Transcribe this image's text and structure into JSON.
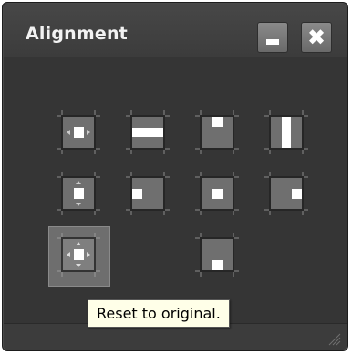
{
  "window": {
    "title": "Alignment",
    "minimize_icon": "minimize-icon",
    "close_icon": "close-icon"
  },
  "alignment_buttons": [
    {
      "name": "center-both-button",
      "icon": "center-both-icon"
    },
    {
      "name": "center-horizontal-stretch-button",
      "icon": "horizontal-stretch-icon"
    },
    {
      "name": "align-top-button",
      "icon": "align-top-icon"
    },
    {
      "name": "center-vertical-stretch-button",
      "icon": "vertical-stretch-icon"
    },
    {
      "name": "center-vertical-arrows-button",
      "icon": "vertical-arrows-icon"
    },
    {
      "name": "align-left-button",
      "icon": "align-left-icon"
    },
    {
      "name": "align-center-button",
      "icon": "align-center-icon"
    },
    {
      "name": "align-right-button",
      "icon": "align-right-icon"
    },
    {
      "name": "reset-to-original-button",
      "icon": "reset-original-icon",
      "selected": true
    },
    {
      "name": "align-bottom-button",
      "icon": "align-bottom-icon"
    }
  ],
  "tooltip": {
    "text": "Reset to original."
  },
  "colors": {
    "panel_bg": "#3a3a3a",
    "button_fill": "#6f6f6f",
    "button_border": "#262626",
    "indicator": "#ffffff",
    "tooltip_bg": "#ffffe8"
  }
}
